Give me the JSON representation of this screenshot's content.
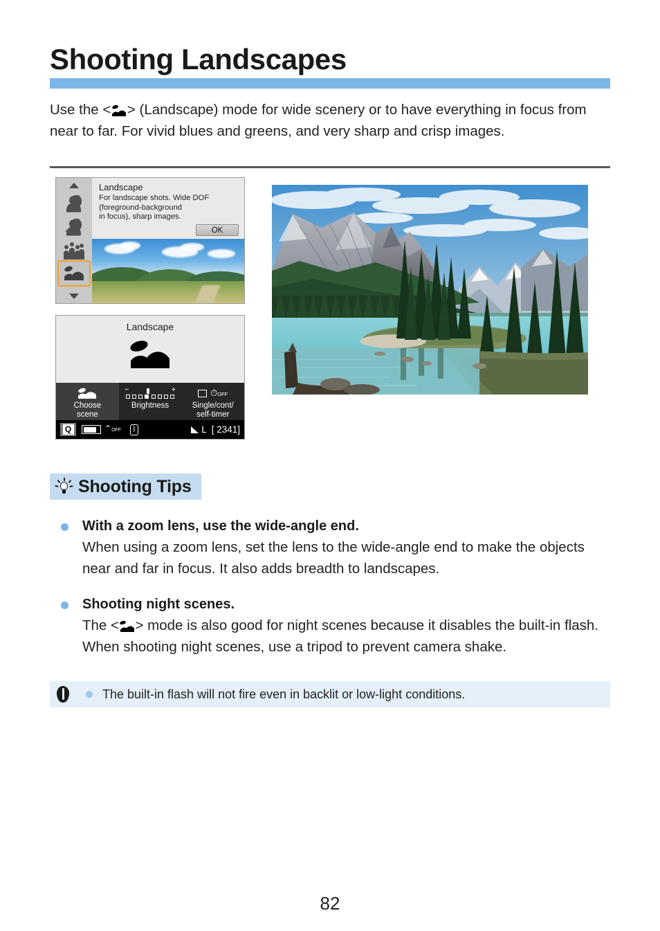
{
  "page": {
    "title": "Shooting Landscapes",
    "number": "82",
    "accent_color": "#7cb5e8",
    "tips_header_bg": "#c5dcf0",
    "note_bg": "#e4eff9"
  },
  "intro": {
    "before_icon": "Use the <",
    "icon": "landscape-mode-icon",
    "after_icon": "> (Landscape) mode for wide scenery or to have everything in focus from near to far. For vivid blues and greens, and very sharp and crisp images."
  },
  "camera_screen_menu": {
    "scroll_up_icon": "triangle-up-icon",
    "scroll_down_icon": "triangle-down-icon",
    "scene_icons": [
      "portrait-scene-icon",
      "smooth-skin-scene-icon",
      "group-photo-scene-icon",
      "landscape-scene-icon"
    ],
    "selected_scene": "landscape-scene-icon",
    "dialog": {
      "title": "Landscape",
      "line1": "For landscape shots. Wide DOF",
      "line2": "(foreground-background",
      "line3": "in focus), sharp images.",
      "ok_label": "OK"
    }
  },
  "camera_screen_quick": {
    "mode_label": "Landscape",
    "mode_icon": "landscape-mode-icon",
    "quick_items": [
      {
        "icon": "landscape-scene-icon",
        "label_line1": "Choose",
        "label_line2": "scene",
        "selected": true
      },
      {
        "icon": "brightness-scale-icon",
        "label_line1": "Brightness",
        "label_line2": "",
        "selected": false
      },
      {
        "icon": "drive-mode-icon",
        "label_line1": "Single/cont/",
        "label_line2": "self-timer",
        "selected": false
      }
    ],
    "brightness": {
      "minus": "−",
      "plus": "+",
      "ticks": 8,
      "active_index": 3
    },
    "status_bar": {
      "q_badge": "Q",
      "battery_icon": "battery-icon",
      "wifi_icon": "wifi-off-icon",
      "wifi_state": "OFF",
      "bluetooth_icon": "bluetooth-icon",
      "quality_icon": "image-quality-icon",
      "quality_label": "L",
      "shots_remaining": "[ 2341]"
    }
  },
  "sample_photo": {
    "name": "landscape-sample-photo",
    "description": "Mountain lake with conifer trees and snow-capped peaks"
  },
  "tips_section": {
    "icon": "lightbulb-icon",
    "header": "Shooting Tips",
    "items": [
      {
        "title": "With a zoom lens, use the wide-angle end.",
        "body": "When using a zoom lens, set the lens to the wide-angle end to make the objects near and far in focus. It also adds breadth to landscapes."
      },
      {
        "title": "Shooting night scenes.",
        "body_before_icon": "The <",
        "body_icon": "landscape-mode-icon",
        "body_after_icon": "> mode is also good for night scenes because it disables the built-in flash. When shooting night scenes, use a tripod to prevent camera shake."
      }
    ]
  },
  "note": {
    "icon": "caution-icon",
    "text": "The built-in flash will not fire even in backlit or low-light conditions."
  }
}
